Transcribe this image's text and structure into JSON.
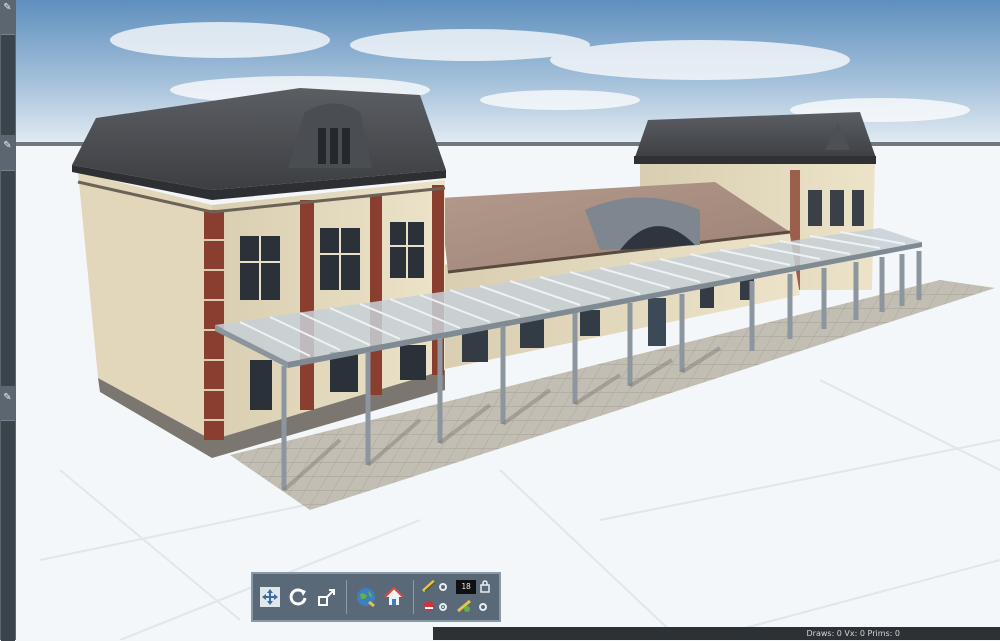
{
  "toolbar": {
    "buttons": [
      {
        "icon": "move-arrows-icon"
      },
      {
        "icon": "rotate-icon"
      },
      {
        "icon": "scale-icon"
      },
      {
        "icon": "globe-icon"
      },
      {
        "icon": "home-icon"
      }
    ],
    "fps_value": "18",
    "options_icons": [
      "train-icon",
      "camera-icon",
      "signal-icon",
      "tree-icon"
    ]
  },
  "status": {
    "text": "Draws: 0 Vx: 0 Prims: 0"
  },
  "colors": {
    "sky_top": "#6f9cc6",
    "sky_bottom": "#dbe7f1",
    "ground": "#f4f7f9",
    "roof": "#4a4c50",
    "wall": "#e7dcc0",
    "brick": "#8a3e30",
    "platform": "#b8b4aa",
    "canopy": "#b9c3cb",
    "toolbar_bg": "#596978",
    "status_bg": "#2c3136"
  }
}
